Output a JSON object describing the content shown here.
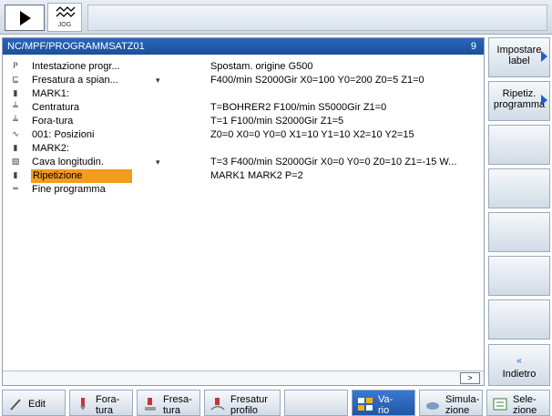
{
  "header": {
    "jog_label": "JOG"
  },
  "program": {
    "path": "NC/MPF/PROGRAMMSATZ01",
    "line_count": "9",
    "rows": [
      {
        "icon": "P",
        "label": "Intestazione progr...",
        "arrow": "",
        "detail": "Spostam. origine G500"
      },
      {
        "icon": "⊑",
        "label": "Fresatura a spian...",
        "arrow": "▾",
        "detail": "F400/min S2000Gir X0=100 Y0=200 Z0=5 Z1=0"
      },
      {
        "icon": "▮",
        "label": "MARK1:",
        "arrow": "",
        "detail": ""
      },
      {
        "icon": "╧",
        "label": "Centratura",
        "arrow": "",
        "detail": "T=BOHRER2 F100/min S5000Gir Z1=0"
      },
      {
        "icon": "╧",
        "label": "Fora-tura",
        "arrow": "",
        "detail": "T=1 F100/min S2000Gir Z1=5"
      },
      {
        "icon": "∿",
        "label": "001: Posizioni",
        "arrow": "",
        "detail": "Z0=0 X0=0 Y0=0 X1=10 Y1=10 X2=10 Y2=15"
      },
      {
        "icon": "▮",
        "label": "MARK2:",
        "arrow": "",
        "detail": ""
      },
      {
        "icon": "▧",
        "label": "Cava longitudin.",
        "arrow": "▾",
        "detail": "T=3 F400/min S2000Gir X0=0 Y0=0 Z0=10 Z1=-15 W..."
      },
      {
        "icon": "▮",
        "label": "Ripetizione",
        "arrow": "",
        "detail": "MARK1 MARK2 P=2"
      },
      {
        "icon": "═",
        "label": "Fine programma",
        "arrow": "",
        "detail": ""
      }
    ],
    "selected_row": "Ripetizione",
    "more_button": ">"
  },
  "vertical_softkeys": {
    "impostare_label": "Impostare\nlabel",
    "ripetiz_programma": "Ripetiz.\nprogramma",
    "back_symbol": "«",
    "indietro": "Indietro"
  },
  "horizontal_softkeys": {
    "edit": "Edit",
    "foratura": "Fora-\ntura",
    "fresatura": "Fresa-\ntura",
    "fresatura_profilo": "Fresatur\nprofilo",
    "vario": "Va-\nrio",
    "simulazione": "Simula-\nzione",
    "selezione": "Sele-\nzione"
  },
  "colors": {
    "title_bar": "#1c4f9a",
    "selected_row": "#f39a1f",
    "accent_arrow": "#1a5fd0"
  }
}
